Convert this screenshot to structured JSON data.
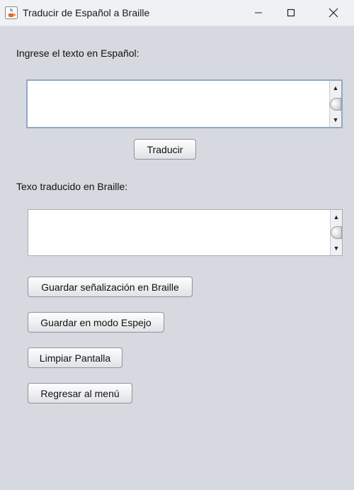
{
  "window": {
    "title": "Traducir de Español a Braille"
  },
  "input_section": {
    "label": "Ingrese el texto en Español:",
    "value": ""
  },
  "translate_button": "Traducir",
  "output_section": {
    "label": "Texo traducido en Braille:",
    "value": ""
  },
  "actions": {
    "save_braille": "Guardar señalización en Braille",
    "save_mirror": "Guardar en modo Espejo",
    "clear": "Limpiar Pantalla",
    "back": "Regresar al menú"
  },
  "colors": {
    "background": "#d6d9e0",
    "titlebar": "#f0f1f4",
    "focus_border": "#7f9db9"
  }
}
